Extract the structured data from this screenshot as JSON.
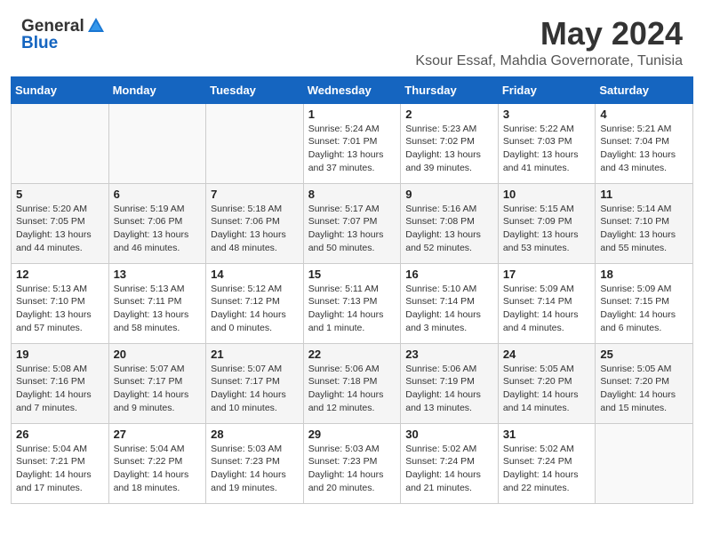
{
  "header": {
    "logo_general": "General",
    "logo_blue": "Blue",
    "month": "May 2024",
    "location": "Ksour Essaf, Mahdia Governorate, Tunisia"
  },
  "weekdays": [
    "Sunday",
    "Monday",
    "Tuesday",
    "Wednesday",
    "Thursday",
    "Friday",
    "Saturday"
  ],
  "weeks": [
    [
      {
        "day": "",
        "info": ""
      },
      {
        "day": "",
        "info": ""
      },
      {
        "day": "",
        "info": ""
      },
      {
        "day": "1",
        "info": "Sunrise: 5:24 AM\nSunset: 7:01 PM\nDaylight: 13 hours and 37 minutes."
      },
      {
        "day": "2",
        "info": "Sunrise: 5:23 AM\nSunset: 7:02 PM\nDaylight: 13 hours and 39 minutes."
      },
      {
        "day": "3",
        "info": "Sunrise: 5:22 AM\nSunset: 7:03 PM\nDaylight: 13 hours and 41 minutes."
      },
      {
        "day": "4",
        "info": "Sunrise: 5:21 AM\nSunset: 7:04 PM\nDaylight: 13 hours and 43 minutes."
      }
    ],
    [
      {
        "day": "5",
        "info": "Sunrise: 5:20 AM\nSunset: 7:05 PM\nDaylight: 13 hours and 44 minutes."
      },
      {
        "day": "6",
        "info": "Sunrise: 5:19 AM\nSunset: 7:06 PM\nDaylight: 13 hours and 46 minutes."
      },
      {
        "day": "7",
        "info": "Sunrise: 5:18 AM\nSunset: 7:06 PM\nDaylight: 13 hours and 48 minutes."
      },
      {
        "day": "8",
        "info": "Sunrise: 5:17 AM\nSunset: 7:07 PM\nDaylight: 13 hours and 50 minutes."
      },
      {
        "day": "9",
        "info": "Sunrise: 5:16 AM\nSunset: 7:08 PM\nDaylight: 13 hours and 52 minutes."
      },
      {
        "day": "10",
        "info": "Sunrise: 5:15 AM\nSunset: 7:09 PM\nDaylight: 13 hours and 53 minutes."
      },
      {
        "day": "11",
        "info": "Sunrise: 5:14 AM\nSunset: 7:10 PM\nDaylight: 13 hours and 55 minutes."
      }
    ],
    [
      {
        "day": "12",
        "info": "Sunrise: 5:13 AM\nSunset: 7:10 PM\nDaylight: 13 hours and 57 minutes."
      },
      {
        "day": "13",
        "info": "Sunrise: 5:13 AM\nSunset: 7:11 PM\nDaylight: 13 hours and 58 minutes."
      },
      {
        "day": "14",
        "info": "Sunrise: 5:12 AM\nSunset: 7:12 PM\nDaylight: 14 hours and 0 minutes."
      },
      {
        "day": "15",
        "info": "Sunrise: 5:11 AM\nSunset: 7:13 PM\nDaylight: 14 hours and 1 minute."
      },
      {
        "day": "16",
        "info": "Sunrise: 5:10 AM\nSunset: 7:14 PM\nDaylight: 14 hours and 3 minutes."
      },
      {
        "day": "17",
        "info": "Sunrise: 5:09 AM\nSunset: 7:14 PM\nDaylight: 14 hours and 4 minutes."
      },
      {
        "day": "18",
        "info": "Sunrise: 5:09 AM\nSunset: 7:15 PM\nDaylight: 14 hours and 6 minutes."
      }
    ],
    [
      {
        "day": "19",
        "info": "Sunrise: 5:08 AM\nSunset: 7:16 PM\nDaylight: 14 hours and 7 minutes."
      },
      {
        "day": "20",
        "info": "Sunrise: 5:07 AM\nSunset: 7:17 PM\nDaylight: 14 hours and 9 minutes."
      },
      {
        "day": "21",
        "info": "Sunrise: 5:07 AM\nSunset: 7:17 PM\nDaylight: 14 hours and 10 minutes."
      },
      {
        "day": "22",
        "info": "Sunrise: 5:06 AM\nSunset: 7:18 PM\nDaylight: 14 hours and 12 minutes."
      },
      {
        "day": "23",
        "info": "Sunrise: 5:06 AM\nSunset: 7:19 PM\nDaylight: 14 hours and 13 minutes."
      },
      {
        "day": "24",
        "info": "Sunrise: 5:05 AM\nSunset: 7:20 PM\nDaylight: 14 hours and 14 minutes."
      },
      {
        "day": "25",
        "info": "Sunrise: 5:05 AM\nSunset: 7:20 PM\nDaylight: 14 hours and 15 minutes."
      }
    ],
    [
      {
        "day": "26",
        "info": "Sunrise: 5:04 AM\nSunset: 7:21 PM\nDaylight: 14 hours and 17 minutes."
      },
      {
        "day": "27",
        "info": "Sunrise: 5:04 AM\nSunset: 7:22 PM\nDaylight: 14 hours and 18 minutes."
      },
      {
        "day": "28",
        "info": "Sunrise: 5:03 AM\nSunset: 7:23 PM\nDaylight: 14 hours and 19 minutes."
      },
      {
        "day": "29",
        "info": "Sunrise: 5:03 AM\nSunset: 7:23 PM\nDaylight: 14 hours and 20 minutes."
      },
      {
        "day": "30",
        "info": "Sunrise: 5:02 AM\nSunset: 7:24 PM\nDaylight: 14 hours and 21 minutes."
      },
      {
        "day": "31",
        "info": "Sunrise: 5:02 AM\nSunset: 7:24 PM\nDaylight: 14 hours and 22 minutes."
      },
      {
        "day": "",
        "info": ""
      }
    ]
  ]
}
